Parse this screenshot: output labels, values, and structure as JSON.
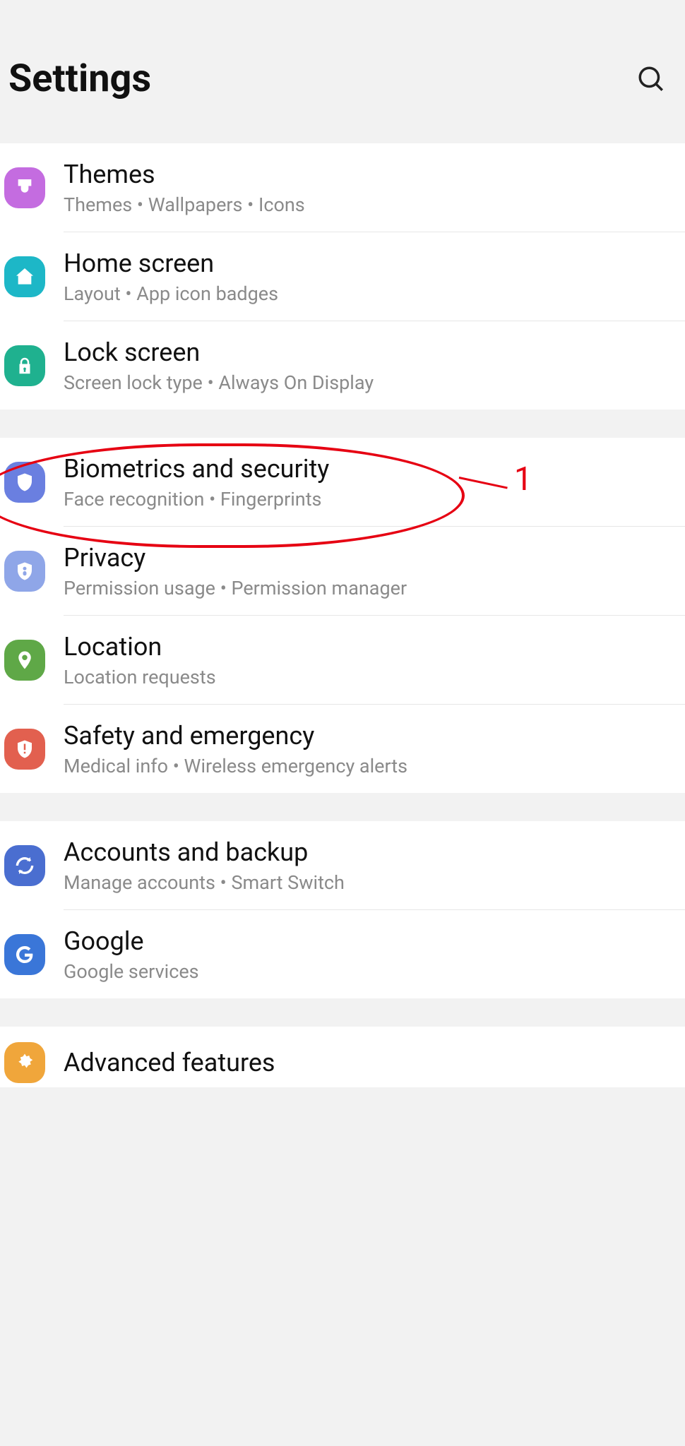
{
  "header": {
    "title": "Settings"
  },
  "groups": [
    {
      "items": [
        {
          "id": "themes",
          "title": "Themes",
          "sub": "Themes  •  Wallpapers  •  Icons",
          "icon": "brush",
          "bg": "#c46ce0"
        },
        {
          "id": "home",
          "title": "Home screen",
          "sub": "Layout  •  App icon badges",
          "icon": "home",
          "bg": "#1db7c7"
        },
        {
          "id": "lock",
          "title": "Lock screen",
          "sub": "Screen lock type  •  Always On Display",
          "icon": "lock",
          "bg": "#1fb18f"
        }
      ]
    },
    {
      "items": [
        {
          "id": "biometrics",
          "title": "Biometrics and security",
          "sub": "Face recognition  •  Fingerprints",
          "icon": "shield",
          "bg": "#6a7fe0"
        },
        {
          "id": "privacy",
          "title": "Privacy",
          "sub": "Permission usage  •  Permission manager",
          "icon": "shield-dot",
          "bg": "#8fa6e8"
        },
        {
          "id": "location",
          "title": "Location",
          "sub": "Location requests",
          "icon": "pin",
          "bg": "#5fa847"
        },
        {
          "id": "safety",
          "title": "Safety and emergency",
          "sub": "Medical info  •  Wireless emergency alerts",
          "icon": "alert",
          "bg": "#e2604f"
        }
      ]
    },
    {
      "items": [
        {
          "id": "accounts",
          "title": "Accounts and backup",
          "sub": "Manage accounts  •  Smart Switch",
          "icon": "sync",
          "bg": "#4a6ed0"
        },
        {
          "id": "google",
          "title": "Google",
          "sub": "Google services",
          "icon": "google",
          "bg": "#3a76d8"
        }
      ]
    },
    {
      "items": [
        {
          "id": "advanced",
          "title": "Advanced features",
          "sub": "",
          "icon": "gear-adv",
          "bg": "#f0a63b"
        }
      ]
    }
  ],
  "annotation": {
    "target": "biometrics",
    "label": "1"
  }
}
